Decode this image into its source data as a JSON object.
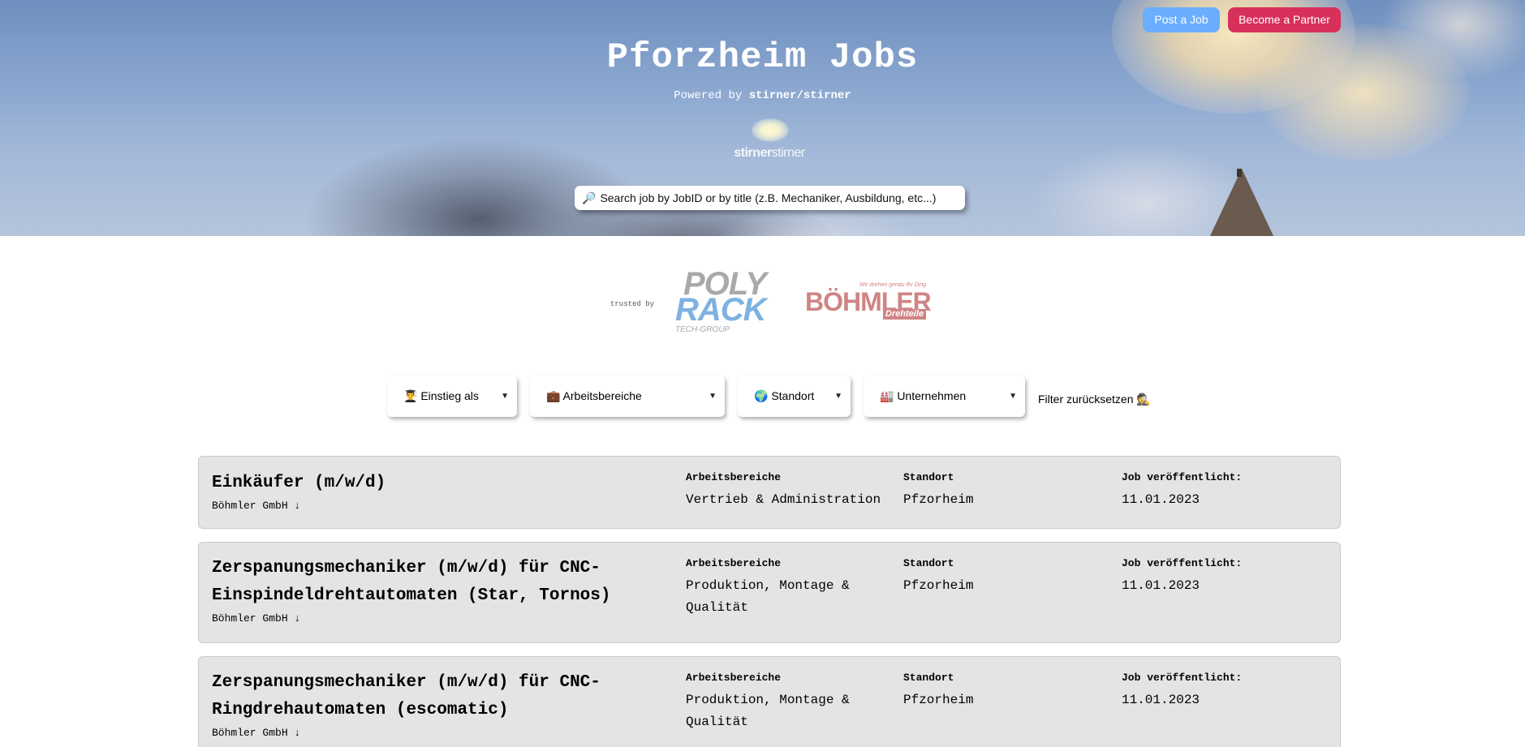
{
  "header": {
    "post_job_label": "Post a Job",
    "partner_label": "Become a Partner",
    "title": "Pforzheim Jobs",
    "powered_prefix": "Powered by",
    "powered_brand": "stirner/stirner",
    "logo_bold": "stirner",
    "logo_light": "stirner"
  },
  "search": {
    "icon": "magnifier-icon",
    "icon_glyph": "🔎",
    "placeholder": "Search job by JobID or by title (z.B. Mechaniker, Ausbildung, etc...)"
  },
  "trusted": {
    "label": "trusted by",
    "polyrack": {
      "line1": "POLY",
      "line2": "RACK",
      "line3": "TECH-GROUP"
    },
    "boehmler": {
      "tagline": "Wir drehen genau Ihr Ding",
      "name": "BÖHMLER",
      "sub": "Drehteile"
    }
  },
  "filters": [
    {
      "label": "👨‍🎓 Einstieg als"
    },
    {
      "label": "💼 Arbeitsbereiche"
    },
    {
      "label": "🌍 Standort"
    },
    {
      "label": "🏭 Unternehmen"
    }
  ],
  "reset_label": "Filter zurücksetzen 🕵️",
  "columns": {
    "area": "Arbeitsbereiche",
    "location": "Standort",
    "date": "Job veröffentlicht:"
  },
  "jobs": [
    {
      "title": "Einkäufer (m/w/d)",
      "company": "Böhmler GmbH ↓",
      "area": "Vertrieb & Administration",
      "location": "Pfzorheim",
      "date": "11.01.2023"
    },
    {
      "title": "Zerspanungsmechaniker (m/w/d) für CNC-Einspindeldrehtautomaten (Star, Tornos)",
      "company": "Böhmler GmbH ↓",
      "area": "Produktion, Montage & Qualität",
      "location": "Pfzorheim",
      "date": "11.01.2023"
    },
    {
      "title": "Zerspanungsmechaniker (m/w/d) für CNC-Ringdrehautomaten (escomatic)",
      "company": "Böhmler GmbH ↓",
      "area": "Produktion, Montage & Qualität",
      "location": "Pfzorheim",
      "date": "11.01.2023"
    }
  ],
  "colors": {
    "post_button": "#6aaeff",
    "partner_button": "#d7315b",
    "card_background": "#e4e4e4",
    "polyrack_gray": "#a9a9ac",
    "polyrack_blue": "#7eb2e0",
    "boehmler_red": "#d08484"
  }
}
